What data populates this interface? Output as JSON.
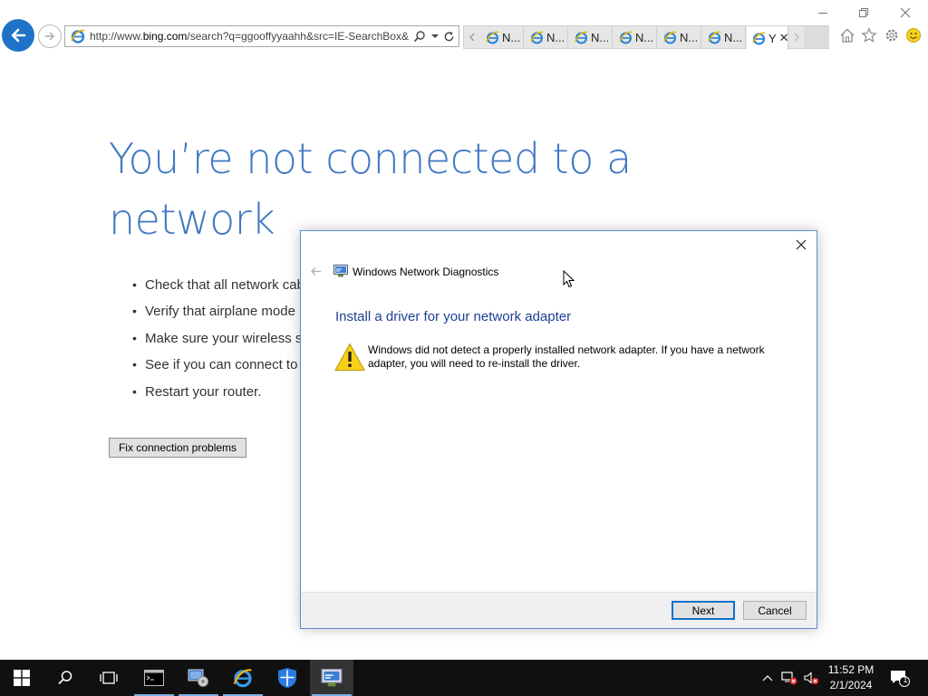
{
  "browser": {
    "url_prefix": "http://www.",
    "url_host": "bing.com",
    "url_rest": "/search?q=ggooffyyaahh&src=IE-SearchBox&",
    "tabs": [
      {
        "label": "N...",
        "active": false
      },
      {
        "label": "N...",
        "active": false
      },
      {
        "label": "N...",
        "active": false
      },
      {
        "label": "N...",
        "active": false
      },
      {
        "label": "N...",
        "active": false
      },
      {
        "label": "N...",
        "active": false
      },
      {
        "label": "Y",
        "active": true
      }
    ],
    "icons": {
      "back": "back-arrow-icon",
      "forward": "forward-arrow-icon",
      "search": "search-icon",
      "refresh": "refresh-icon",
      "home": "home-icon",
      "favorites": "star-icon",
      "tools": "gear-icon",
      "feedback": "smiley-icon"
    },
    "accent_color": "#1e73c8"
  },
  "page": {
    "title": "You’re not connected to a network",
    "tips": [
      "Check that all network cab",
      "Verify that airplane mode",
      "Make sure your wireless sv",
      "See if you can connect to",
      "Restart your router."
    ],
    "fix_button": "Fix connection problems",
    "title_color": "#3f78c3"
  },
  "dialog": {
    "app_title": "Windows Network Diagnostics",
    "heading": "Install a driver for your network adapter",
    "message": "Windows did not detect a properly installed network adapter. If you have a network adapter, you will need to re-install the driver.",
    "next_button": "Next",
    "cancel_button": "Cancel",
    "heading_color": "#1c3f95"
  },
  "taskbar": {
    "time": "11:52 PM",
    "date": "2/1/2024",
    "notification_count": "1",
    "items": [
      "start-icon",
      "search-icon",
      "task-view-icon",
      "command-prompt-icon",
      "server-manager-icon",
      "internet-explorer-icon",
      "windows-defender-icon",
      "network-diagnostics-icon"
    ]
  }
}
